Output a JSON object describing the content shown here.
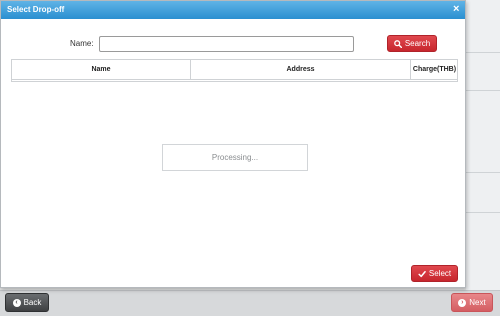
{
  "dialog": {
    "title": "Select Drop-off",
    "close_glyph": "×",
    "name_label": "Name:",
    "name_value": "",
    "name_placeholder": "",
    "search_label": "Search",
    "search_icon": "search-icon",
    "table": {
      "columns": [
        "Name",
        "Address",
        "Charge(THB)"
      ],
      "rows": []
    },
    "processing_text": "Processing...",
    "select_label": "Select",
    "select_icon": "check-icon"
  },
  "footer": {
    "back_label": "Back",
    "back_icon": "chevron-left-icon",
    "next_label": "Next",
    "next_icon": "chevron-right-icon"
  },
  "colors": {
    "header_blue": "#2a8fd0",
    "primary_red": "#c7262d",
    "next_pink": "#d45d62",
    "back_dark": "#3e4042"
  }
}
